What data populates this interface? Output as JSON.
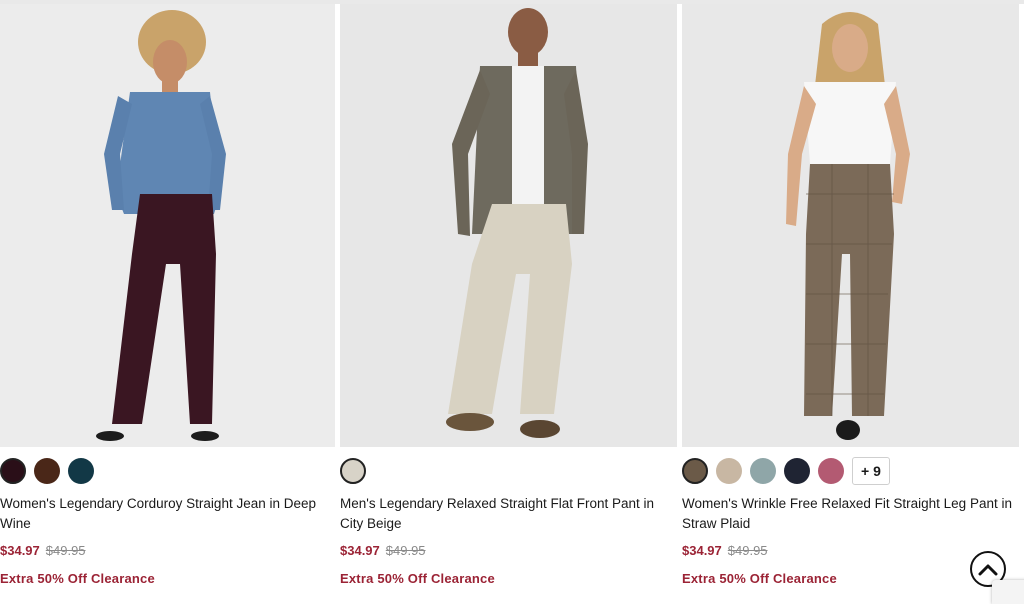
{
  "products": [
    {
      "title": "Women's Legendary Corduroy Straight Jean in Deep Wine",
      "sale_price": "$34.97",
      "original_price": "$49.95",
      "promo": "Extra 50% Off Clearance",
      "swatches": [
        "#2a0f18",
        "#4a2718",
        "#123846"
      ],
      "selected_swatch": 0
    },
    {
      "title": "Men's Legendary Relaxed Straight Flat Front Pant in City Beige",
      "sale_price": "$34.97",
      "original_price": "$49.95",
      "promo": "Extra 50% Off Clearance",
      "swatches": [
        "#d8d3c8"
      ],
      "selected_swatch": 0
    },
    {
      "title": "Women's Wrinkle Free Relaxed Fit Straight Leg Pant in Straw Plaid",
      "sale_price": "$34.97",
      "original_price": "$49.95",
      "promo": "Extra 50% Off Clearance",
      "swatches": [
        "#6b5a48",
        "#c8b7a3",
        "#8fa6a8",
        "#1f2433",
        "#b35a72"
      ],
      "selected_swatch": 0,
      "more_colors": "+ 9"
    }
  ],
  "icons": {
    "scroll_top": "chevron-up-icon"
  },
  "colors": {
    "sale": "#9b2335",
    "strike": "#8a8a8a"
  }
}
